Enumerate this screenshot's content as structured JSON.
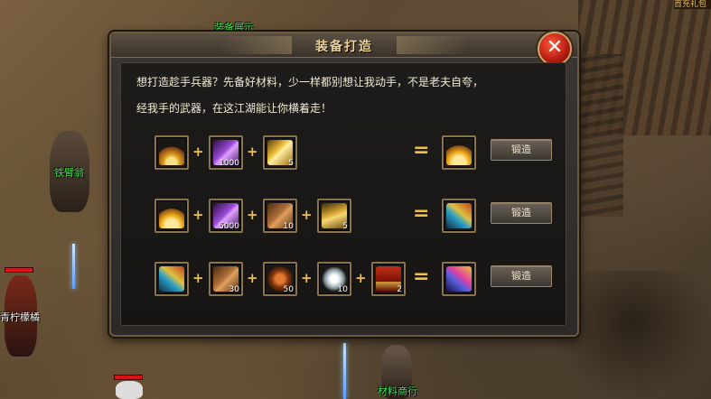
{
  "world": {
    "npc_top": "装备展示",
    "npc_left": "铁臂翁",
    "npc_bottom": "材料商行",
    "player": "青柠檬橘",
    "top_right": "首充礼包"
  },
  "dialog": {
    "title": "装备打造",
    "close_icon": "close-x-icon",
    "intro_line1": "想打造趁手兵器？先备好材料，少一样都别想让我动手，不是老夫自夸，",
    "intro_line2": "经我手的武器，在这江湖能让你横着走！",
    "recipes": [
      {
        "inputs": [
          {
            "icon": "fan-weapon-icon",
            "qty": ""
          },
          {
            "icon": "purple-crystal-icon",
            "qty": "1000"
          },
          {
            "icon": "gold-bar-icon",
            "qty": "5"
          }
        ],
        "output": {
          "icon": "golden-fan-icon"
        },
        "button": "锻造"
      },
      {
        "inputs": [
          {
            "icon": "golden-fan-icon",
            "qty": ""
          },
          {
            "icon": "purple-crystal-icon",
            "qty": "5000"
          },
          {
            "icon": "leather-bundle-icon",
            "qty": "10"
          },
          {
            "icon": "gold-box-icon",
            "qty": "5"
          }
        ],
        "output": {
          "icon": "feather-fan-icon"
        },
        "button": "锻造"
      },
      {
        "inputs": [
          {
            "icon": "feather-fan-icon",
            "qty": ""
          },
          {
            "icon": "leather-bundle-icon",
            "qty": "30"
          },
          {
            "icon": "bronze-disc-icon",
            "qty": "50"
          },
          {
            "icon": "silver-ore-icon",
            "qty": "10"
          },
          {
            "icon": "treasure-chest-icon",
            "qty": "2"
          }
        ],
        "output": {
          "icon": "violet-feather-fan-icon"
        },
        "button": "锻造"
      }
    ]
  }
}
